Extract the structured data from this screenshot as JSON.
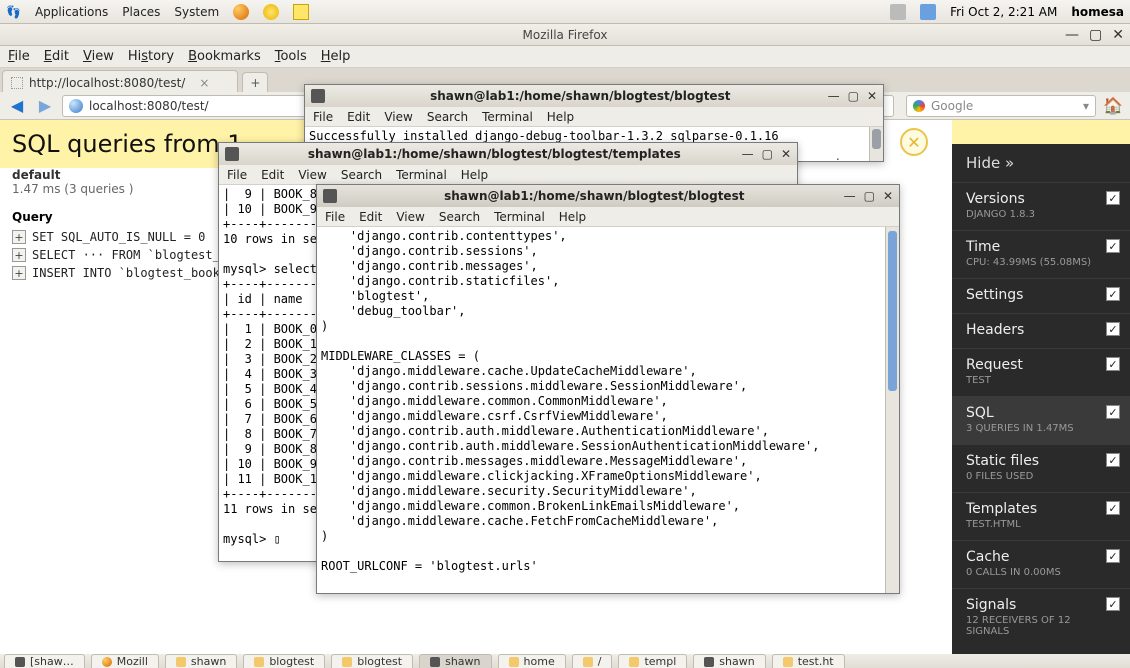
{
  "gnome": {
    "apps": "Applications",
    "places": "Places",
    "system": "System",
    "clock": "Fri Oct  2,  2:21 AM",
    "user": "homesa"
  },
  "firefox": {
    "title": "Mozilla Firefox",
    "menu": {
      "file": "File",
      "edit": "Edit",
      "view": "View",
      "history": "History",
      "bookmarks": "Bookmarks",
      "tools": "Tools",
      "help": "Help"
    },
    "tab_label": "http://localhost:8080/test/",
    "url": "localhost:8080/test/",
    "search_placeholder": "Google"
  },
  "sql": {
    "heading_prefix": "SQL queries from 1 ",
    "default_label": "default",
    "timing": "1.47 ms (3 queries )",
    "query_hdr": "Query",
    "rows": [
      "SET SQL_AUTO_IS_NULL = 0",
      "SELECT ··· FROM `blogtest_b",
      "INSERT INTO `blogtest_book`"
    ]
  },
  "ddt": {
    "hide": "Hide »",
    "panels": [
      {
        "title": "Versions",
        "sub": "Django 1.8.3"
      },
      {
        "title": "Time",
        "sub": "CPU: 43.99ms (55.08ms)"
      },
      {
        "title": "Settings",
        "sub": ""
      },
      {
        "title": "Headers",
        "sub": ""
      },
      {
        "title": "Request",
        "sub": "TEST"
      },
      {
        "title": "SQL",
        "sub": "3 queries in 1.47ms",
        "active": true
      },
      {
        "title": "Static files",
        "sub": "0 files used"
      },
      {
        "title": "Templates",
        "sub": "test.html"
      },
      {
        "title": "Cache",
        "sub": "0 calls in 0.00ms"
      },
      {
        "title": "Signals",
        "sub": "12 receivers of 12 signals"
      }
    ]
  },
  "term1": {
    "title": "shawn@lab1:/home/shawn/blogtest/blogtest",
    "menu": {
      "file": "File",
      "edit": "Edit",
      "view": "View",
      "search": "Search",
      "terminal": "Terminal",
      "help": "Help"
    },
    "line": "Successfully installed django-debug-toolbar-1.3.2 sqlparse-0.1.16",
    "line2": "sgi.py"
  },
  "term2": {
    "title": "shawn@lab1:/home/shawn/blogtest/blogtest/templates",
    "menu": {
      "file": "File",
      "edit": "Edit",
      "view": "View",
      "search": "Search",
      "terminal": "Terminal",
      "help": "Help"
    },
    "body_left": "|  9 | BOOK_8\n| 10 | BOOK_9\n+----+--------\n10 rows in set\n\nmysql> select\n+----+--------\n| id | name\n+----+--------\n|  1 | BOOK_0\n|  2 | BOOK_1\n|  3 | BOOK_2\n|  4 | BOOK_3\n|  5 | BOOK_4\n|  6 | BOOK_5\n|  7 | BOOK_6\n|  8 | BOOK_7\n|  9 | BOOK_8\n| 10 | BOOK_9\n| 11 | BOOK_10\n+----+--------\n11 rows in set\n\nmysql> ▯"
  },
  "term3": {
    "title": "shawn@lab1:/home/shawn/blogtest/blogtest",
    "menu": {
      "file": "File",
      "edit": "Edit",
      "view": "View",
      "search": "Search",
      "terminal": "Terminal",
      "help": "Help"
    },
    "body": "    'django.contrib.contenttypes',\n    'django.contrib.sessions',\n    'django.contrib.messages',\n    'django.contrib.staticfiles',\n    'blogtest',\n    'debug_toolbar',\n)\n\nMIDDLEWARE_CLASSES = (\n    'django.middleware.cache.UpdateCacheMiddleware',\n    'django.contrib.sessions.middleware.SessionMiddleware',\n    'django.middleware.common.CommonMiddleware',\n    'django.middleware.csrf.CsrfViewMiddleware',\n    'django.contrib.auth.middleware.AuthenticationMiddleware',\n    'django.contrib.auth.middleware.SessionAuthenticationMiddleware',\n    'django.contrib.messages.middleware.MessageMiddleware',\n    'django.middleware.clickjacking.XFrameOptionsMiddleware',\n    'django.middleware.security.SecurityMiddleware',\n    'django.middleware.common.BrokenLinkEmailsMiddleware',\n    'django.middleware.cache.FetchFromCacheMiddleware',\n)\n\nROOT_URLCONF = 'blogtest.urls'"
  },
  "taskbar": {
    "items": [
      {
        "label": "[shaw…",
        "icon": "term"
      },
      {
        "label": "Mozill",
        "icon": "ff"
      },
      {
        "label": "shawn",
        "icon": "folder"
      },
      {
        "label": "blogtest",
        "icon": "folder"
      },
      {
        "label": "blogtest",
        "icon": "folder"
      },
      {
        "label": "shawn",
        "icon": "term",
        "active": true
      },
      {
        "label": "home",
        "icon": "folder"
      },
      {
        "label": "/",
        "icon": "folder"
      },
      {
        "label": "templ",
        "icon": "folder"
      },
      {
        "label": "shawn",
        "icon": "term"
      },
      {
        "label": "test.ht",
        "icon": "folder"
      }
    ]
  }
}
